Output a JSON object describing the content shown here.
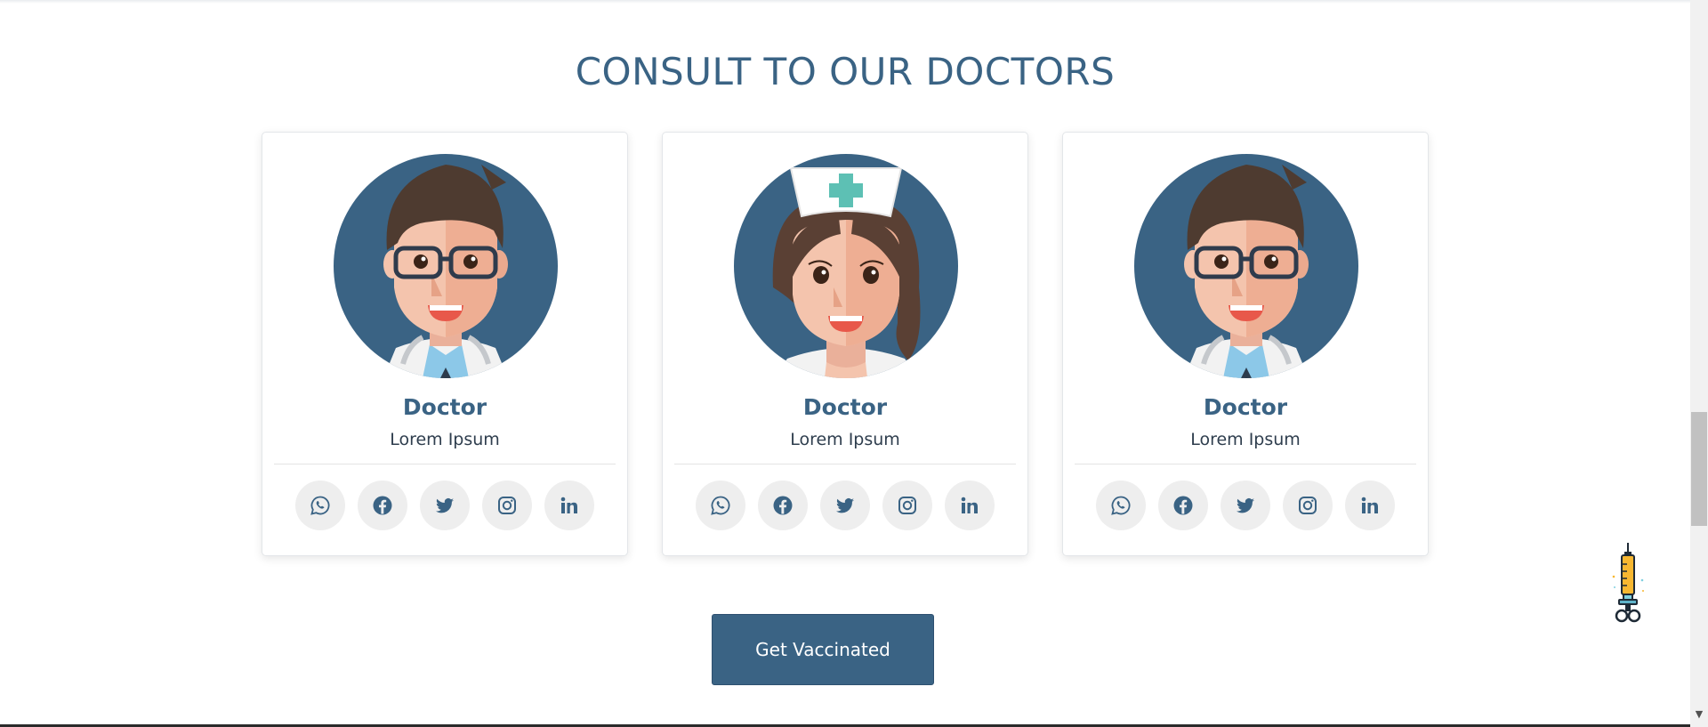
{
  "section": {
    "title": "CONSULT TO OUR DOCTORS"
  },
  "doctors": [
    {
      "name": "Doctor",
      "role": "Lorem Ipsum",
      "avatar": "male-doctor-avatar"
    },
    {
      "name": "Doctor",
      "role": "Lorem Ipsum",
      "avatar": "nurse-avatar"
    },
    {
      "name": "Doctor",
      "role": "Lorem Ipsum",
      "avatar": "male-doctor-avatar"
    }
  ],
  "social_icons": [
    "whatsapp-icon",
    "facebook-icon",
    "twitter-icon",
    "instagram-icon",
    "linkedin-icon"
  ],
  "cta": {
    "label": "Get Vaccinated"
  },
  "colors": {
    "primary": "#3a6384",
    "text_dark": "#2f3e4e",
    "icon_bg": "#eeeeee",
    "skin": "#f4c4ad",
    "hair": "#4e3b30"
  }
}
